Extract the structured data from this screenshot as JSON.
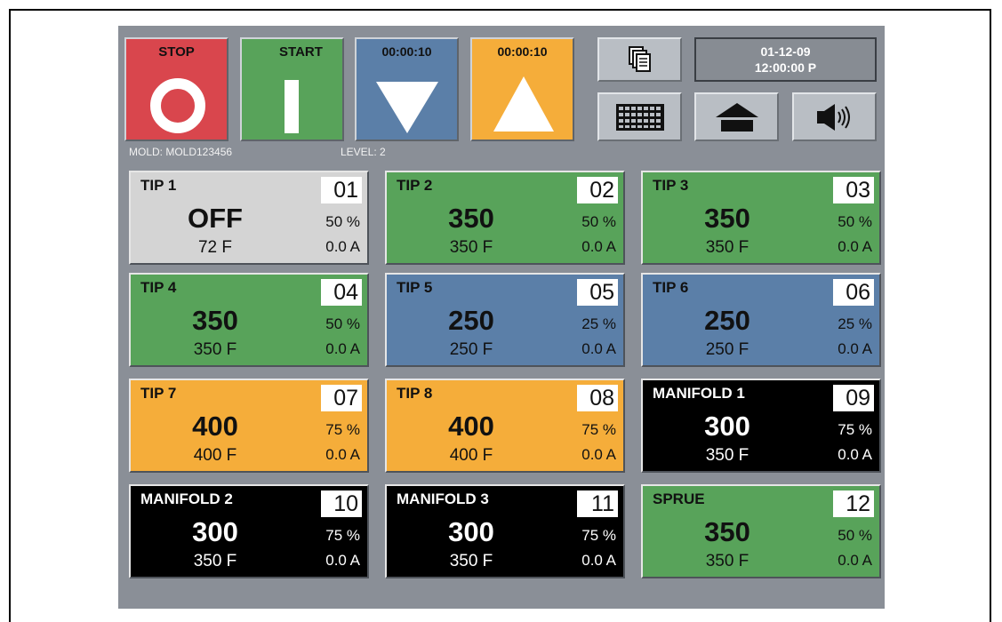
{
  "controls": {
    "stop_label": "STOP",
    "start_label": "START",
    "timer_down": "00:00:10",
    "timer_up": "00:00:10",
    "date": "01-12-09",
    "time": "12:00:00 P"
  },
  "status": {
    "mold": "MOLD: MOLD123456",
    "level": "LEVEL: 2"
  },
  "colors": {
    "stop": "#d9464d",
    "start": "#58a35a",
    "blue": "#5b7fa8",
    "orange": "#f5ad3a",
    "off": "#d4d4d4",
    "black": "#000000",
    "panel": "#8a8f97"
  },
  "icons": {
    "stop": "stop-ring-icon",
    "start": "start-bar-icon",
    "timer_down": "down-triangle-icon",
    "timer_up": "up-triangle-icon",
    "copy": "copy-pages-icon",
    "keypad": "keypad-grid-icon",
    "home": "home-icon",
    "sound": "speaker-icon"
  },
  "zones": [
    {
      "name": "TIP 1",
      "num": "01",
      "setpoint": "OFF",
      "percent": "50 %",
      "actual": "72 F",
      "amps": "0.0 A",
      "color": "off"
    },
    {
      "name": "TIP 2",
      "num": "02",
      "setpoint": "350",
      "percent": "50 %",
      "actual": "350 F",
      "amps": "0.0 A",
      "color": "start"
    },
    {
      "name": "TIP 3",
      "num": "03",
      "setpoint": "350",
      "percent": "50 %",
      "actual": "350 F",
      "amps": "0.0 A",
      "color": "start"
    },
    {
      "name": "TIP 4",
      "num": "04",
      "setpoint": "350",
      "percent": "50 %",
      "actual": "350 F",
      "amps": "0.0 A",
      "color": "start"
    },
    {
      "name": "TIP 5",
      "num": "05",
      "setpoint": "250",
      "percent": "25 %",
      "actual": "250 F",
      "amps": "0.0 A",
      "color": "blue"
    },
    {
      "name": "TIP 6",
      "num": "06",
      "setpoint": "250",
      "percent": "25 %",
      "actual": "250 F",
      "amps": "0.0 A",
      "color": "blue"
    },
    {
      "name": "TIP 7",
      "num": "07",
      "setpoint": "400",
      "percent": "75 %",
      "actual": "400 F",
      "amps": "0.0 A",
      "color": "orange"
    },
    {
      "name": "TIP 8",
      "num": "08",
      "setpoint": "400",
      "percent": "75 %",
      "actual": "400 F",
      "amps": "0.0 A",
      "color": "orange"
    },
    {
      "name": "MANIFOLD 1",
      "num": "09",
      "setpoint": "300",
      "percent": "75 %",
      "actual": "350 F",
      "amps": "0.0 A",
      "color": "black"
    },
    {
      "name": "MANIFOLD 2",
      "num": "10",
      "setpoint": "300",
      "percent": "75 %",
      "actual": "350 F",
      "amps": "0.0 A",
      "color": "black"
    },
    {
      "name": "MANIFOLD 3",
      "num": "11",
      "setpoint": "300",
      "percent": "75 %",
      "actual": "350 F",
      "amps": "0.0 A",
      "color": "black"
    },
    {
      "name": "SPRUE",
      "num": "12",
      "setpoint": "350",
      "percent": "50 %",
      "actual": "350 F",
      "amps": "0.0 A",
      "color": "start"
    }
  ]
}
